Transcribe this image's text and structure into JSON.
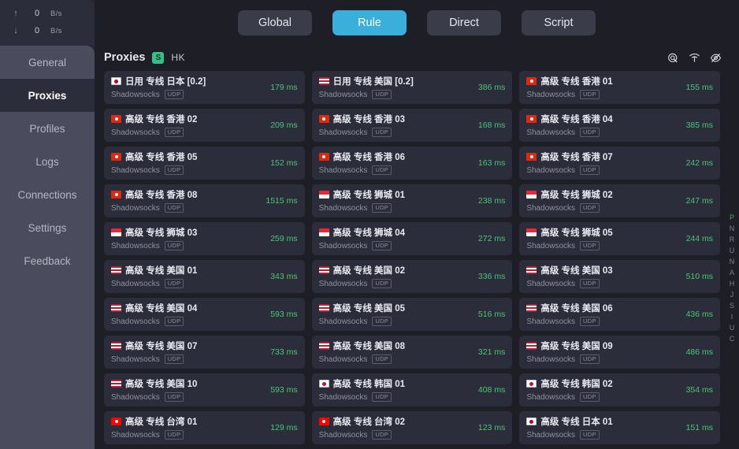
{
  "traffic": {
    "upload": {
      "arrow": "↑",
      "value": "0",
      "unit": "B/s"
    },
    "download": {
      "arrow": "↓",
      "value": "0",
      "unit": "B/s"
    }
  },
  "sidebar": {
    "items": [
      {
        "label": "General",
        "active": false
      },
      {
        "label": "Proxies",
        "active": true
      },
      {
        "label": "Profiles",
        "active": false
      },
      {
        "label": "Logs",
        "active": false
      },
      {
        "label": "Connections",
        "active": false
      },
      {
        "label": "Settings",
        "active": false
      },
      {
        "label": "Feedback",
        "active": false
      }
    ]
  },
  "modes": [
    {
      "label": "Global",
      "active": false
    },
    {
      "label": "Rule",
      "active": true
    },
    {
      "label": "Direct",
      "active": false
    },
    {
      "label": "Script",
      "active": false
    }
  ],
  "proxies_header": {
    "title": "Proxies",
    "badge": "S",
    "group": "HK",
    "icons": [
      {
        "name": "speed-test-icon"
      },
      {
        "name": "signal-icon"
      },
      {
        "name": "hide-eye-icon"
      }
    ]
  },
  "colors": {
    "accent": "#3aafdc",
    "delay_good": "#48c774",
    "badge_green": "#35c08a",
    "sidebar": "#4a4b5c",
    "panel": "#2c2d3a",
    "background": "#1d1e26"
  },
  "proxies": [
    {
      "flag": "jp",
      "name": "日用 专线 日本 [0.2]",
      "protocol": "Shadowsocks",
      "udp": "UDP",
      "delay": "179 ms"
    },
    {
      "flag": "us",
      "name": "日用 专线 美国 [0.2]",
      "protocol": "Shadowsocks",
      "udp": "UDP",
      "delay": "386 ms"
    },
    {
      "flag": "hk",
      "name": "高级 专线 香港 01",
      "protocol": "Shadowsocks",
      "udp": "UDP",
      "delay": "155 ms"
    },
    {
      "flag": "hk",
      "name": "高级 专线 香港 02",
      "protocol": "Shadowsocks",
      "udp": "UDP",
      "delay": "209 ms"
    },
    {
      "flag": "hk",
      "name": "高级 专线 香港 03",
      "protocol": "Shadowsocks",
      "udp": "UDP",
      "delay": "168 ms"
    },
    {
      "flag": "hk",
      "name": "高级 专线 香港 04",
      "protocol": "Shadowsocks",
      "udp": "UDP",
      "delay": "385 ms"
    },
    {
      "flag": "hk",
      "name": "高级 专线 香港 05",
      "protocol": "Shadowsocks",
      "udp": "UDP",
      "delay": "152 ms"
    },
    {
      "flag": "hk",
      "name": "高级 专线 香港 06",
      "protocol": "Shadowsocks",
      "udp": "UDP",
      "delay": "163 ms"
    },
    {
      "flag": "hk",
      "name": "高级 专线 香港 07",
      "protocol": "Shadowsocks",
      "udp": "UDP",
      "delay": "242 ms"
    },
    {
      "flag": "hk",
      "name": "高级 专线 香港 08",
      "protocol": "Shadowsocks",
      "udp": "UDP",
      "delay": "1515 ms"
    },
    {
      "flag": "sg",
      "name": "高级 专线 狮城 01",
      "protocol": "Shadowsocks",
      "udp": "UDP",
      "delay": "238 ms"
    },
    {
      "flag": "sg",
      "name": "高级 专线 狮城 02",
      "protocol": "Shadowsocks",
      "udp": "UDP",
      "delay": "247 ms"
    },
    {
      "flag": "sg",
      "name": "高级 专线 狮城 03",
      "protocol": "Shadowsocks",
      "udp": "UDP",
      "delay": "259 ms"
    },
    {
      "flag": "sg",
      "name": "高级 专线 狮城 04",
      "protocol": "Shadowsocks",
      "udp": "UDP",
      "delay": "272 ms"
    },
    {
      "flag": "sg",
      "name": "高级 专线 狮城 05",
      "protocol": "Shadowsocks",
      "udp": "UDP",
      "delay": "244 ms"
    },
    {
      "flag": "us",
      "name": "高级 专线 美国 01",
      "protocol": "Shadowsocks",
      "udp": "UDP",
      "delay": "343 ms"
    },
    {
      "flag": "us",
      "name": "高级 专线 美国 02",
      "protocol": "Shadowsocks",
      "udp": "UDP",
      "delay": "336 ms"
    },
    {
      "flag": "us",
      "name": "高级 专线 美国 03",
      "protocol": "Shadowsocks",
      "udp": "UDP",
      "delay": "510 ms"
    },
    {
      "flag": "us",
      "name": "高级 专线 美国 04",
      "protocol": "Shadowsocks",
      "udp": "UDP",
      "delay": "593 ms"
    },
    {
      "flag": "us",
      "name": "高级 专线 美国 05",
      "protocol": "Shadowsocks",
      "udp": "UDP",
      "delay": "516 ms"
    },
    {
      "flag": "us",
      "name": "高级 专线 美国 06",
      "protocol": "Shadowsocks",
      "udp": "UDP",
      "delay": "436 ms"
    },
    {
      "flag": "us",
      "name": "高级 专线 美国 07",
      "protocol": "Shadowsocks",
      "udp": "UDP",
      "delay": "733 ms"
    },
    {
      "flag": "us",
      "name": "高级 专线 美国 08",
      "protocol": "Shadowsocks",
      "udp": "UDP",
      "delay": "321 ms"
    },
    {
      "flag": "us",
      "name": "高级 专线 美国 09",
      "protocol": "Shadowsocks",
      "udp": "UDP",
      "delay": "486 ms"
    },
    {
      "flag": "us",
      "name": "高级 专线 美国 10",
      "protocol": "Shadowsocks",
      "udp": "UDP",
      "delay": "593 ms"
    },
    {
      "flag": "kr",
      "name": "高级 专线 韩国 01",
      "protocol": "Shadowsocks",
      "udp": "UDP",
      "delay": "408 ms"
    },
    {
      "flag": "kr",
      "name": "高级 专线 韩国 02",
      "protocol": "Shadowsocks",
      "udp": "UDP",
      "delay": "354 ms"
    },
    {
      "flag": "tw",
      "name": "高级 专线 台湾 01",
      "protocol": "Shadowsocks",
      "udp": "UDP",
      "delay": "129 ms"
    },
    {
      "flag": "tw",
      "name": "高级 专线 台湾 02",
      "protocol": "Shadowsocks",
      "udp": "UDP",
      "delay": "123 ms"
    },
    {
      "flag": "jp",
      "name": "高级 专线 日本 01",
      "protocol": "Shadowsocks",
      "udp": "UDP",
      "delay": "151 ms"
    }
  ],
  "index_rail": [
    {
      "letter": "P",
      "active": true
    },
    {
      "letter": "N",
      "active": false
    },
    {
      "letter": "R",
      "active": false
    },
    {
      "letter": "U",
      "active": false
    },
    {
      "letter": "N",
      "active": false
    },
    {
      "letter": "A",
      "active": false
    },
    {
      "letter": "H",
      "active": false
    },
    {
      "letter": "J",
      "active": false
    },
    {
      "letter": "S",
      "active": false
    },
    {
      "letter": "I",
      "active": false
    },
    {
      "letter": "U",
      "active": false
    },
    {
      "letter": "C",
      "active": false
    }
  ]
}
